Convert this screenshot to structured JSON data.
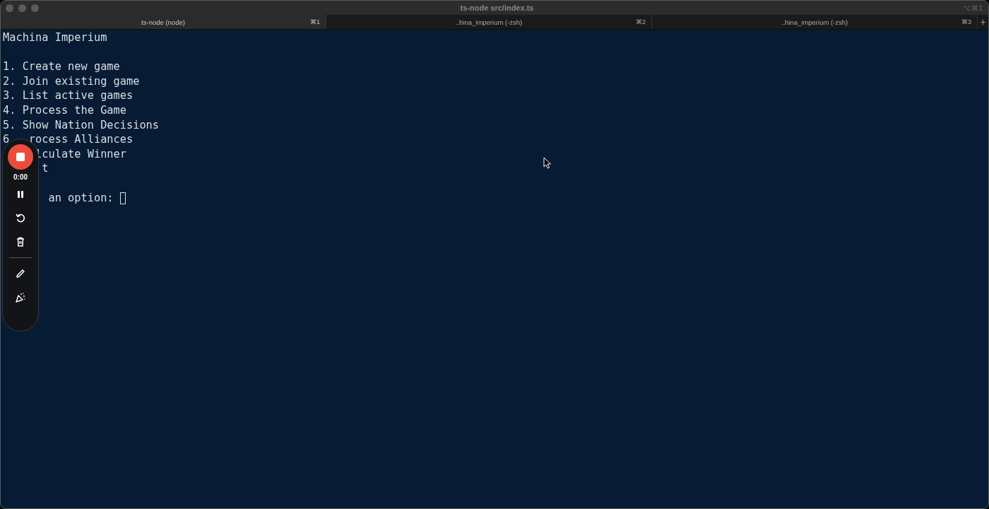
{
  "window": {
    "title": "ts-node src/index.ts",
    "shortcut": "⌥⌘1"
  },
  "tabs": [
    {
      "label": "ts-node (node)",
      "shortcut": "⌘1",
      "selected": true
    },
    {
      "label": "..hina_imperium (-zsh)",
      "shortcut": "⌘2",
      "selected": false
    },
    {
      "label": "..hina_imperium (-zsh)",
      "shortcut": "⌘3",
      "selected": false
    }
  ],
  "new_tab": "+",
  "terminal": {
    "lines": [
      {
        "kind": "heading",
        "parts": [
          "Machina Imperium"
        ]
      },
      {
        "kind": "menu",
        "parts": [
          "1. Create new game"
        ]
      },
      {
        "kind": "menu",
        "parts": [
          "2. Join existing game"
        ]
      },
      {
        "kind": "menu",
        "parts": [
          "3. List active games"
        ]
      },
      {
        "kind": "menu",
        "parts": [
          "4. Process the Game"
        ]
      },
      {
        "kind": "menu",
        "parts": [
          "5. Show Nation Decisions"
        ]
      },
      {
        "kind": "menu",
        "parts": [
          "6",
          "rocess Alliances"
        ]
      },
      {
        "kind": "menu",
        "parts": [
          "lculate Winner"
        ]
      },
      {
        "kind": "menu",
        "parts": [
          "t"
        ]
      },
      {
        "kind": "prompt",
        "parts": [
          "an option:"
        ]
      }
    ]
  },
  "recorder": {
    "timer": "0:00"
  }
}
